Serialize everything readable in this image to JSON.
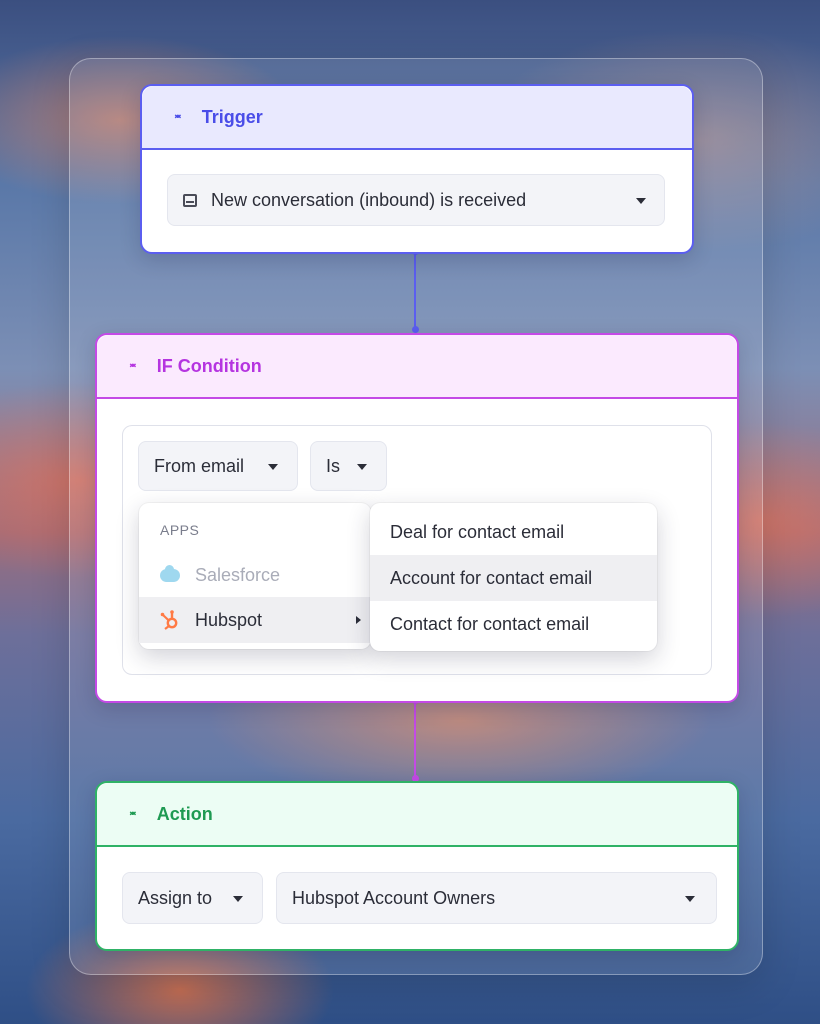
{
  "trigger": {
    "title": "Trigger",
    "select_value": "New conversation (inbound) is received"
  },
  "condition": {
    "title": "IF Condition",
    "field_select": "From email",
    "operator_select": "Is",
    "apps_menu": {
      "section_label": "APPS",
      "items": [
        {
          "label": "Salesforce",
          "icon": "salesforce-cloud-icon",
          "disabled": true
        },
        {
          "label": "Hubspot",
          "icon": "hubspot-icon",
          "highlighted": true
        }
      ]
    },
    "submenu": {
      "items": [
        {
          "label": "Deal for contact email"
        },
        {
          "label": "Account for contact email",
          "highlighted": true
        },
        {
          "label": "Contact for contact email"
        }
      ]
    }
  },
  "action": {
    "title": "Action",
    "verb_select": "Assign to",
    "target_select": "Hubspot Account Owners"
  },
  "colors": {
    "trigger_accent": "#5b5ef0",
    "condition_accent": "#c44ae6",
    "action_accent": "#2fb266",
    "hubspot_orange": "#ff7a45",
    "salesforce_blue": "#9fd8ef"
  }
}
